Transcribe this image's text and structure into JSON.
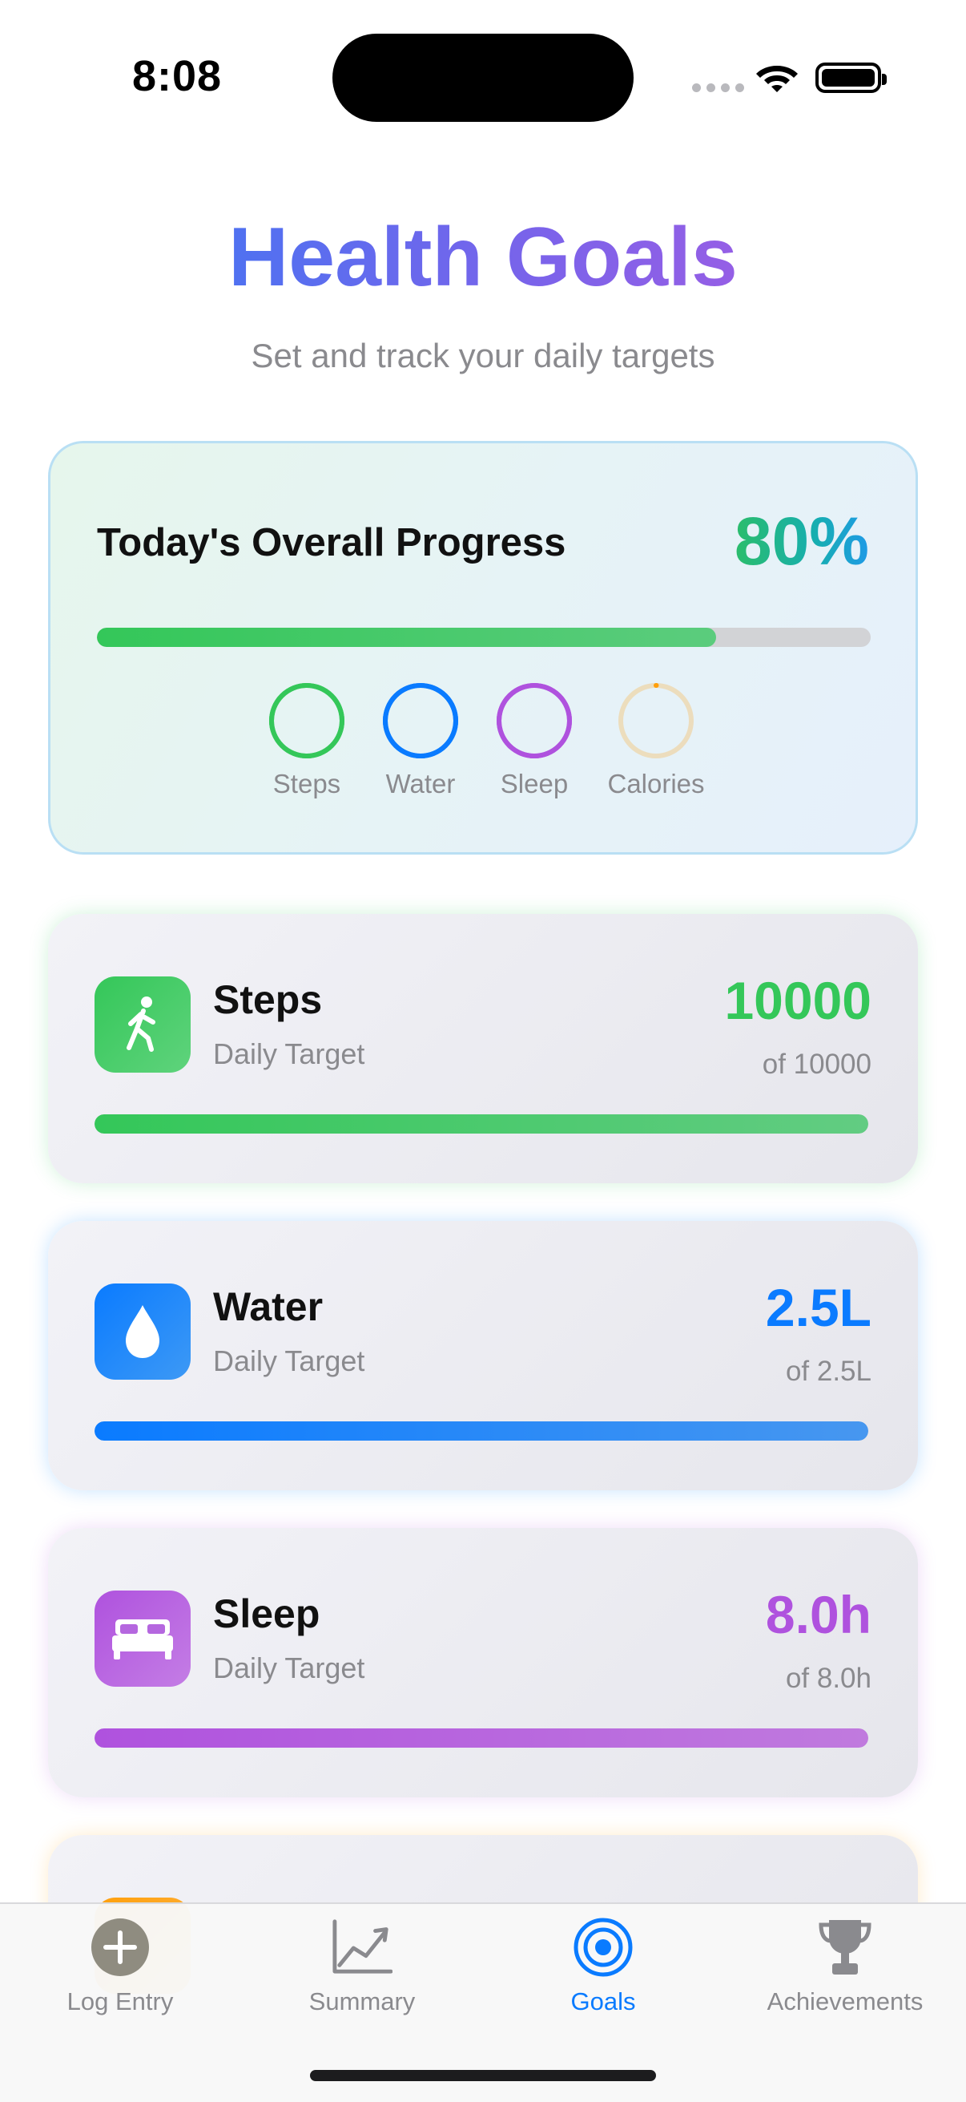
{
  "status_bar": {
    "time": "8:08"
  },
  "header": {
    "title": "Health Goals",
    "subtitle": "Set and track your daily targets"
  },
  "overall": {
    "label": "Today's Overall Progress",
    "value": "80%",
    "progress": 0.8,
    "rings": [
      {
        "label": "Steps",
        "progress": 1.0,
        "color": "#34c759"
      },
      {
        "label": "Water",
        "progress": 1.0,
        "color": "#0a7bff"
      },
      {
        "label": "Sleep",
        "progress": 1.0,
        "color": "#af52de"
      },
      {
        "label": "Calories",
        "progress": 0.0,
        "color": "#ff9f0a"
      }
    ]
  },
  "goals": [
    {
      "name": "Steps",
      "subtitle": "Daily Target",
      "value": "10000",
      "target": "of 10000",
      "progress": 1.0,
      "icon": "figure-walk-icon",
      "color": "#34c759"
    },
    {
      "name": "Water",
      "subtitle": "Daily Target",
      "value": "2.5L",
      "target": "of 2.5L",
      "progress": 1.0,
      "icon": "water-drop-icon",
      "color": "#0a7bff"
    },
    {
      "name": "Sleep",
      "subtitle": "Daily Target",
      "value": "8.0h",
      "target": "of 8.0h",
      "progress": 1.0,
      "icon": "bed-icon",
      "color": "#af52de"
    },
    {
      "icon": "flame-icon",
      "color": "#ff9f0a"
    }
  ],
  "tab_bar": {
    "tabs": [
      {
        "label": "Log Entry",
        "icon": "plus-circle-icon",
        "active": false
      },
      {
        "label": "Summary",
        "icon": "chart-line-icon",
        "active": false
      },
      {
        "label": "Goals",
        "icon": "target-icon",
        "active": true
      },
      {
        "label": "Achievements",
        "icon": "trophy-icon",
        "active": false
      }
    ]
  }
}
